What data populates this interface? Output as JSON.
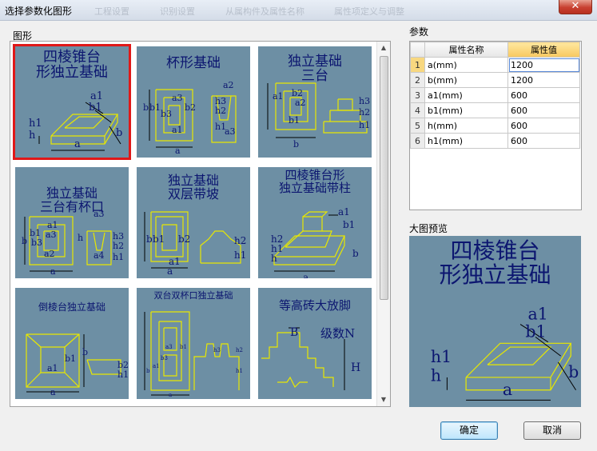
{
  "window": {
    "title": "选择参数化图形",
    "close_glyph": "✕",
    "ghost_tabs": [
      "工程设置",
      "识别设置",
      "从属构件及属性名称",
      "属性项定义与调整"
    ]
  },
  "gallery": {
    "label": "图形",
    "items": [
      {
        "title": "四棱锥台\n形独立基础",
        "size": 18,
        "selected": true,
        "labels": [
          "a1",
          "b1",
          "h1",
          "h",
          "a",
          "b"
        ]
      },
      {
        "title": "杯形基础",
        "size": 17,
        "selected": false,
        "labels": [
          "a2",
          "b",
          "b1",
          "b3",
          "a3",
          "b2",
          "a",
          "a1",
          "h3",
          "h2",
          "h1",
          "a3"
        ]
      },
      {
        "title": "独立基础\n三台",
        "size": 17,
        "selected": false,
        "labels": [
          "a1",
          "b2",
          "b1",
          "a2",
          "b",
          "h3",
          "h2",
          "h1"
        ]
      },
      {
        "title": "独立基础\n三台有杯口",
        "size": 16,
        "selected": false,
        "labels": [
          "a1",
          "b1",
          "a3",
          "b3",
          "a2",
          "b",
          "a",
          "a3",
          "h",
          "a4",
          "h3",
          "h2",
          "h1"
        ]
      },
      {
        "title": "独立基础\n双层带坡",
        "size": 16,
        "selected": false,
        "labels": [
          "b",
          "b1",
          "a1",
          "b2",
          "a",
          "h2",
          "h1"
        ]
      },
      {
        "title": "四棱锥台形\n独立基础带柱",
        "size": 15,
        "selected": false,
        "labels": [
          "a1",
          "b1",
          "h2",
          "h1",
          "h",
          "b",
          "a"
        ]
      },
      {
        "title": "倒棱台独立基础",
        "size": 12,
        "selected": false,
        "labels": [
          "b1",
          "b",
          "a1",
          "a",
          "b2",
          "h1"
        ]
      },
      {
        "title": "双台双杯口独立基础",
        "size": 11,
        "selected": false,
        "labels": [
          "a3",
          "b3",
          "b1",
          "a1",
          "b",
          "h3",
          "h2",
          "h1",
          "a"
        ]
      },
      {
        "title": "等高砖大放脚",
        "size": 15,
        "selected": false,
        "labels": [
          "B",
          "级数N",
          "H"
        ]
      }
    ]
  },
  "params": {
    "label": "参数",
    "headers": [
      "属性名称",
      "属性值"
    ],
    "rows": [
      {
        "no": "1",
        "name": "a(mm)",
        "value": "1200",
        "selected": true
      },
      {
        "no": "2",
        "name": "b(mm)",
        "value": "1200",
        "selected": false
      },
      {
        "no": "3",
        "name": "a1(mm)",
        "value": "600",
        "selected": false
      },
      {
        "no": "4",
        "name": "b1(mm)",
        "value": "600",
        "selected": false
      },
      {
        "no": "5",
        "name": "h(mm)",
        "value": "600",
        "selected": false
      },
      {
        "no": "6",
        "name": "h1(mm)",
        "value": "600",
        "selected": false
      }
    ]
  },
  "preview": {
    "label": "大图预览",
    "title": "四棱锥台\n形独立基础",
    "labels": [
      "a1",
      "b1",
      "h1",
      "h",
      "a",
      "b"
    ]
  },
  "buttons": {
    "ok": "确定",
    "cancel": "取消"
  },
  "scrollbar": {
    "up": "▲",
    "down": "▼"
  },
  "colors": {
    "drawing_bg": "#6d8fa4",
    "outline": "#e8e800",
    "label": "#0c1670",
    "selection": "#e01818"
  }
}
